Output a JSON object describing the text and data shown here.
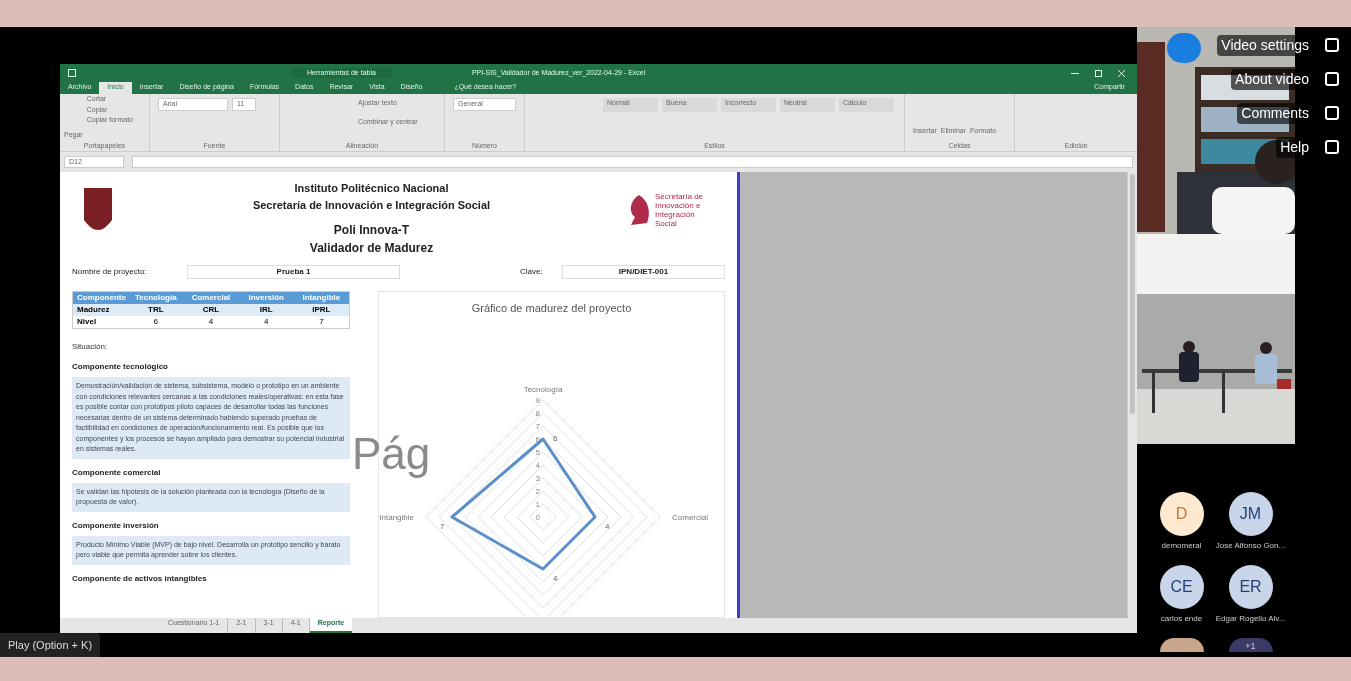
{
  "excel": {
    "context_title": "Herramientas de tabla",
    "window_title": "PPI-SIS_Validador de Madurez_ver_2022-04-29 - Excel",
    "share": "Compartir",
    "tabs": [
      {
        "label": "Archivo",
        "selected": false
      },
      {
        "label": "Inicio",
        "selected": true
      },
      {
        "label": "Insertar",
        "selected": false
      },
      {
        "label": "Diseño de página",
        "selected": false
      },
      {
        "label": "Fórmulas",
        "selected": false
      },
      {
        "label": "Datos",
        "selected": false
      },
      {
        "label": "Revisar",
        "selected": false
      },
      {
        "label": "Vista",
        "selected": false
      },
      {
        "label": "Diseño",
        "selected": false
      }
    ],
    "tell_me": "¿Qué desea hacer?",
    "clipboard": {
      "paste": "Pegar",
      "items": [
        "Cortar",
        "Copiar",
        "Copiar formato"
      ]
    },
    "groups": [
      "Portapapeles",
      "Fuente",
      "Alineación",
      "Número",
      "Estilos",
      "Celdas",
      "Edición"
    ],
    "font_name": "Arial",
    "font_size": "11",
    "wrap": "Ajustar texto",
    "merge": "Combinar y centrar",
    "number_format": "General",
    "styles": [
      "Normal",
      "Buena",
      "Incorrecto",
      "Neutral",
      "Cálculo"
    ],
    "cells_buttons": [
      "Insertar",
      "Eliminar",
      "Formato"
    ],
    "name_box": "D12"
  },
  "sheet": {
    "header": [
      "Instituto Politécnico Nacional",
      "Secretaría de Innovación e Integración Social"
    ],
    "subheader": [
      "Poli Innova-T",
      "Validador de Madurez"
    ],
    "logo_text": "Secretaría de Innovación e Integración Social",
    "project_label": "Nombre de proyecto:",
    "project_value": "Prueba 1",
    "key_label": "Clave:",
    "key_value": "IPN/DIET-001",
    "table": {
      "columns": [
        "Componente",
        "Tecnología",
        "Comercial",
        "Inversión",
        "Intangible"
      ],
      "rows": [
        [
          "Madurez",
          "TRL",
          "CRL",
          "IRL",
          "IPRL"
        ],
        [
          "Nivel",
          "6",
          "4",
          "4",
          "7"
        ]
      ]
    },
    "situation": "Situación:",
    "sections": [
      {
        "title": "Componente tecnológico",
        "text": "Demostración/validación de sistema, subsistema, modelo o prototipo en un ambiente con condiciones relevantes cercanas a las condiciones reales/operativas: en esta fase es posible contar con prototipos piloto capaces de desarrollar todas las funciones necesarias dentro de un sistema determinado habiendo superado pruebas de factibilidad en condiciones de operación/funcionamiento real. Es posible que los componentes y los procesos se hayan ampliado para demostrar su potencial industrial en sistemas reales."
      },
      {
        "title": "Componente comercial",
        "text": "Se validan las hipótesis de la solución planteada con la tecnología (Diseño de la propuesta de valor)."
      },
      {
        "title": "Componente inversión",
        "text": "Producto Mínimo Viable (MVP) de bajo nivel. Desarrolla un prototipo sencillo y barato pero viable que permita aprender sobre los clientes."
      },
      {
        "title": "Componente de activos intangibles"
      }
    ],
    "page_watermark": "Pág",
    "maturity_chart": {
      "title": "Gráfico de madurez del proyecto",
      "tick_labels": [
        "9",
        "8",
        "7",
        "6",
        "5",
        "4",
        "3",
        "2",
        "1",
        "0"
      ],
      "axes": [
        {
          "label": "Tecnología",
          "value": "6"
        },
        {
          "label": "Comercial",
          "value": "4"
        },
        {
          "value": "4"
        },
        {
          "label": "Intangible",
          "value": "7"
        }
      ]
    },
    "sheet_tabs": [
      {
        "label": "Cuestionario 1-1",
        "selected": false
      },
      {
        "label": "2-1",
        "selected": false
      },
      {
        "label": "3-1",
        "selected": false
      },
      {
        "label": "4-1",
        "selected": false
      },
      {
        "label": "Reporte",
        "selected": true
      }
    ]
  },
  "video_menu": [
    "Video settings",
    "About video",
    "Comments",
    "Help"
  ],
  "participants": [
    {
      "initials": "D",
      "name": "demomeral",
      "color": "#fde9d0"
    },
    {
      "initials": "JM",
      "name": "Jose Alfonso Gon...",
      "color": "#c9d6ea"
    },
    {
      "initials": "CE",
      "name": "carlos ende",
      "color": "#c9d6ea"
    },
    {
      "initials": "ER",
      "name": "Edgar Rogelio Alv...",
      "color": "#c9d6ea"
    }
  ],
  "more_participants": "+1",
  "play_hint": "Play (Option + K)"
}
